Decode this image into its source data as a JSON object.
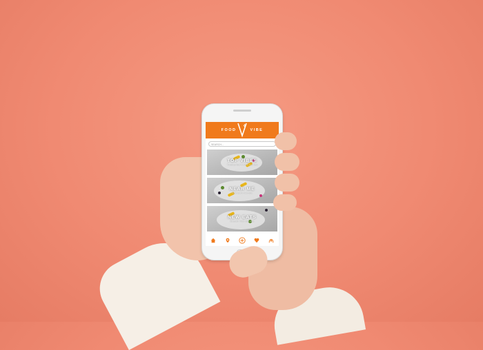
{
  "app": {
    "brand_left": "FOOD",
    "brand_right": "VIBE",
    "accent_color": "#f07a1c"
  },
  "search": {
    "placeholder": "SEARCH..."
  },
  "cards": [
    {
      "title": "TOP VIBES",
      "subtitle": "Trending food & drink near you"
    },
    {
      "title": "NEAR ME",
      "subtitle": "Food spots near you"
    },
    {
      "title": "NEW EATS",
      "subtitle": "Discover fresh new eats"
    }
  ],
  "nav": {
    "icons": [
      "home-icon",
      "location-pin-icon",
      "add-icon",
      "heart-icon",
      "profile-icon"
    ]
  }
}
